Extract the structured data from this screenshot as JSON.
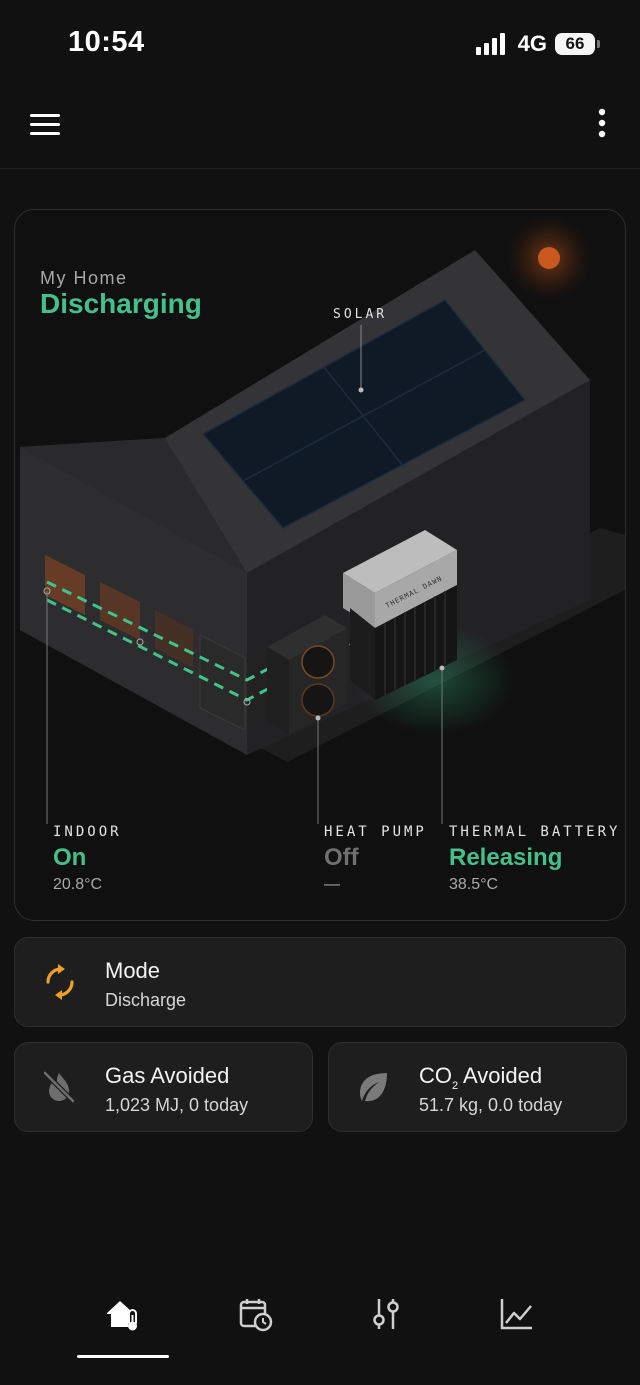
{
  "status_bar": {
    "time": "10:54",
    "network": "4G",
    "battery": "66"
  },
  "hero": {
    "home_label": "My Home",
    "home_state": "Discharging",
    "solar_label": "SOLAR",
    "battery_brand": "THERMAL DAWN",
    "stats": {
      "indoor": {
        "title": "INDOOR",
        "value": "On",
        "sub": "20.8°C"
      },
      "heat_pump": {
        "title": "HEAT PUMP",
        "value": "Off",
        "sub": "—"
      },
      "thermal_battery": {
        "title": "THERMAL BATTERY",
        "value": "Releasing",
        "sub": "38.5°C"
      }
    }
  },
  "mode_card": {
    "title": "Mode",
    "value": "Discharge"
  },
  "gas_card": {
    "title": "Gas Avoided",
    "value": "1,023 MJ, 0 today"
  },
  "co2_card": {
    "title_main": "CO",
    "title_sub": "2",
    "title_rest": " Avoided",
    "value": "51.7 kg, 0.0 today"
  },
  "colors": {
    "accent_green": "#45c08a",
    "accent_orange": "#f0a020",
    "sun": "#c8581e",
    "background": "#111111",
    "card": "#1e1e1e"
  },
  "nav": {
    "items": [
      {
        "icon": "home-thermometer-icon",
        "active": true
      },
      {
        "icon": "calendar-clock-icon",
        "active": false
      },
      {
        "icon": "sliders-icon",
        "active": false
      },
      {
        "icon": "chart-line-icon",
        "active": false
      }
    ]
  }
}
